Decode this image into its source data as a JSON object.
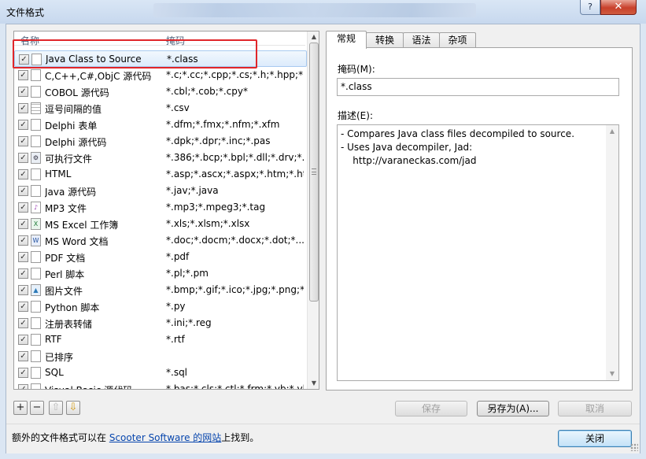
{
  "window": {
    "title": "文件格式",
    "help_label": "?",
    "close_label": "✕"
  },
  "list": {
    "col_name": "名称",
    "col_mask": "掩码",
    "rows": [
      {
        "name": "Java Class to Source",
        "mask": "*.class",
        "icon": "doc"
      },
      {
        "name": "C,C++,C#,ObjC 源代码",
        "mask": "*.c;*.cc;*.cpp;*.cs;*.h;*.hpp;*.m",
        "icon": "doc"
      },
      {
        "name": "COBOL 源代码",
        "mask": "*.cbl;*.cob;*.cpy*",
        "icon": "doc"
      },
      {
        "name": "逗号间隔的值",
        "mask": "*.csv",
        "icon": "grid"
      },
      {
        "name": "Delphi 表单",
        "mask": "*.dfm;*.fmx;*.nfm;*.xfm",
        "icon": "doc"
      },
      {
        "name": "Delphi 源代码",
        "mask": "*.dpk;*.dpr;*.inc;*.pas",
        "icon": "doc"
      },
      {
        "name": "可执行文件",
        "mask": "*.386;*.bcp;*.bpl;*.dll;*.drv;*....",
        "icon": "exe"
      },
      {
        "name": "HTML",
        "mask": "*.asp;*.ascx;*.aspx;*.htm;*.ht...",
        "icon": "doc"
      },
      {
        "name": "Java 源代码",
        "mask": "*.jav;*.java",
        "icon": "doc"
      },
      {
        "name": "MP3 文件",
        "mask": "*.mp3;*.mpeg3;*.tag",
        "icon": "music"
      },
      {
        "name": "MS Excel 工作簿",
        "mask": "*.xls;*.xlsm;*.xlsx",
        "icon": "xls"
      },
      {
        "name": "MS Word 文档",
        "mask": "*.doc;*.docm;*.docx;*.dot;*....",
        "icon": "word"
      },
      {
        "name": "PDF 文档",
        "mask": "*.pdf",
        "icon": "doc"
      },
      {
        "name": "Perl 脚本",
        "mask": "*.pl;*.pm",
        "icon": "doc"
      },
      {
        "name": "图片文件",
        "mask": "*.bmp;*.gif;*.ico;*.jpg;*.png;*....",
        "icon": "img"
      },
      {
        "name": "Python 脚本",
        "mask": "*.py",
        "icon": "doc"
      },
      {
        "name": "注册表转储",
        "mask": "*.ini;*.reg",
        "icon": "doc"
      },
      {
        "name": "RTF",
        "mask": "*.rtf",
        "icon": "doc"
      },
      {
        "name": "已排序",
        "mask": "",
        "icon": "doc"
      },
      {
        "name": "SQL",
        "mask": "*.sql",
        "icon": "doc"
      },
      {
        "name": "Visual Basic 源代码",
        "mask": "*.bas;*.cls;*.ctl;*.frm;*.vb;*.vb...",
        "icon": "doc"
      }
    ],
    "selected_index": 0
  },
  "toolbar": {
    "add": "+",
    "remove": "−",
    "up": "⇧",
    "down": "⇩"
  },
  "tabs": [
    "常规",
    "转换",
    "语法",
    "杂项"
  ],
  "general": {
    "mask_label": "掩码(M):",
    "mask_value": "*.class",
    "desc_label": "描述(E):",
    "desc_text": "- Compares Java class files decompiled to source.\n- Uses Java decompiler, Jad:\n    http://varaneckas.com/jad"
  },
  "buttons": {
    "save": "保存",
    "save_as": "另存为(A)...",
    "cancel": "取消",
    "close": "关闭"
  },
  "footer": {
    "prefix": "额外的文件格式可以在 ",
    "link": "Scooter Software 的网站",
    "suffix": "上找到。"
  }
}
